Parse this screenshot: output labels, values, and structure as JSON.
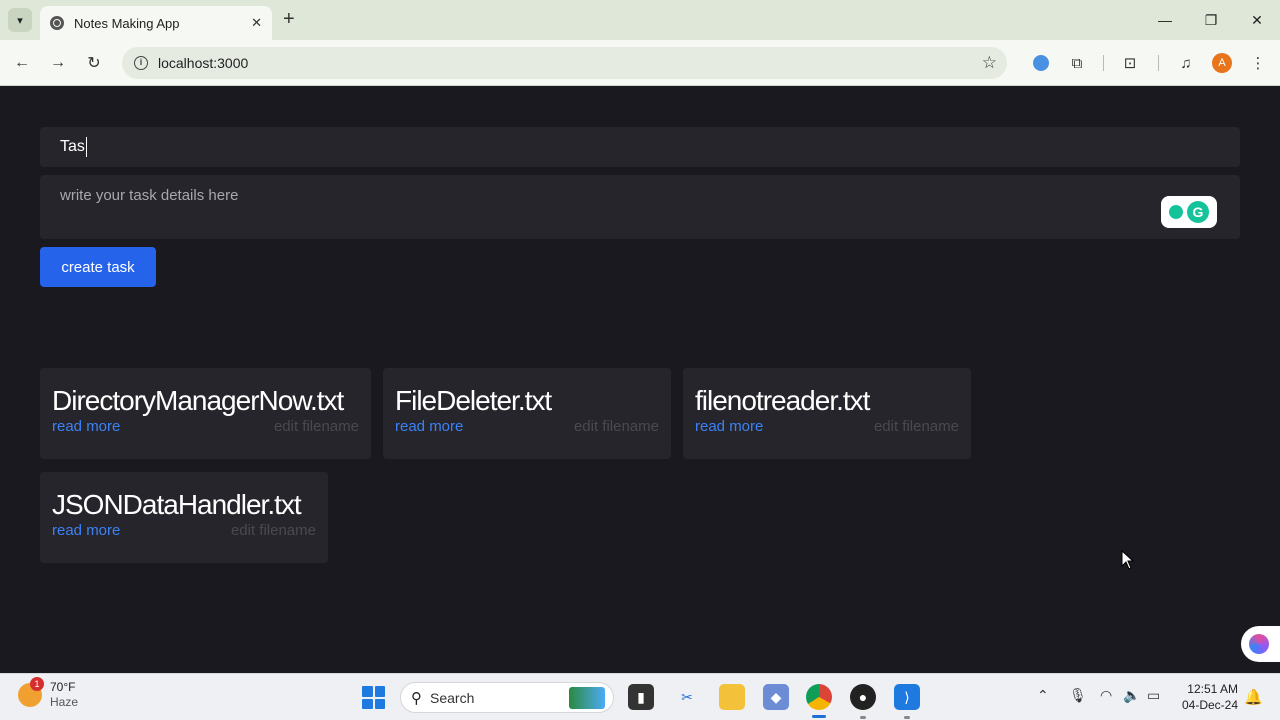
{
  "browser": {
    "tab_title": "Notes Making App",
    "url": "localhost:3000",
    "profile_initial": "A",
    "window_controls": [
      "minimize",
      "restore",
      "close"
    ]
  },
  "form": {
    "title_value": "Tas",
    "details_placeholder": "write your task details here",
    "create_button": "create task"
  },
  "cards": [
    {
      "title": "DirectoryManagerNow.txt",
      "read_more": "read more",
      "edit": "edit filename"
    },
    {
      "title": "FileDeleter.txt",
      "read_more": "read more",
      "edit": "edit filename"
    },
    {
      "title": "filenotreader.txt",
      "read_more": "read more",
      "edit": "edit filename"
    },
    {
      "title": "JSONDataHandler.txt",
      "read_more": "read more",
      "edit": "edit filename"
    }
  ],
  "taskbar": {
    "weather_temp": "70°F",
    "weather_desc": "Haze",
    "weather_badge": "1",
    "search_label": "Search",
    "time": "12:51 AM",
    "date": "04-Dec-24"
  },
  "colors": {
    "page_bg": "#1a191f",
    "input_bg": "#26252c",
    "accent": "#2563eb",
    "link": "#3b82f6"
  }
}
